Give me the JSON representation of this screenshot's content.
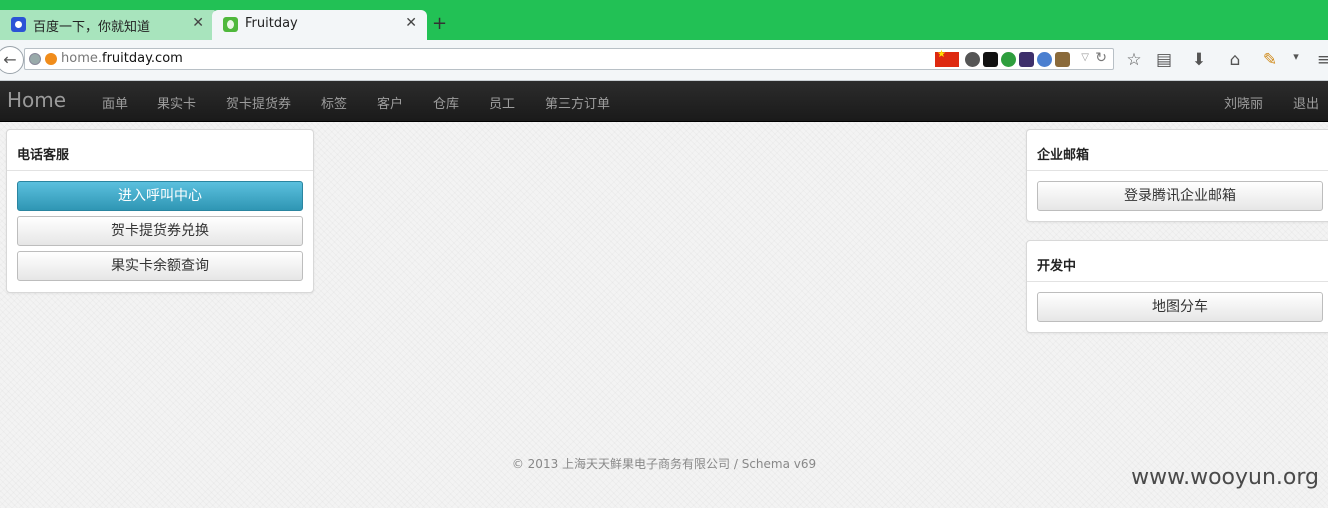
{
  "browser": {
    "tabs": [
      {
        "title": "百度一下，你就知道",
        "favicon": "baidu-paw-icon",
        "active": false
      },
      {
        "title": "Fruitday",
        "favicon": "fruitday-apple-icon",
        "active": true
      }
    ],
    "close_glyph": "✕",
    "new_tab_glyph": "+",
    "url": {
      "host_prefix": "home.",
      "host_domain": "fruitday.com"
    },
    "toolbar_icons": [
      "star-icon",
      "reading-list-icon",
      "download-icon",
      "home-icon",
      "extension-icon",
      "menu-dropdown-icon",
      "hamburger-menu-icon"
    ]
  },
  "site": {
    "brand": "Home",
    "nav": [
      "面单",
      "果实卡",
      "贺卡提货券",
      "标签",
      "客户",
      "仓库",
      "员工",
      "第三方订单"
    ],
    "user_name": "刘晓丽",
    "logout": "退出"
  },
  "panels": {
    "phone_service": {
      "title": "电话客服",
      "buttons": [
        "进入呼叫中心",
        "贺卡提货券兑换",
        "果实卡余额查询"
      ]
    },
    "enterprise_mail": {
      "title": "企业邮箱",
      "button": "登录腾讯企业邮箱"
    },
    "in_development": {
      "title": "开发中",
      "button": "地图分车"
    }
  },
  "footer": "© 2013 上海天天鲜果电子商务有限公司 / Schema v69",
  "watermark": "www.wooyun.org",
  "colors": {
    "tabbar": "#22c155",
    "primary_button": "#49afcd",
    "navbar": "#222222"
  }
}
